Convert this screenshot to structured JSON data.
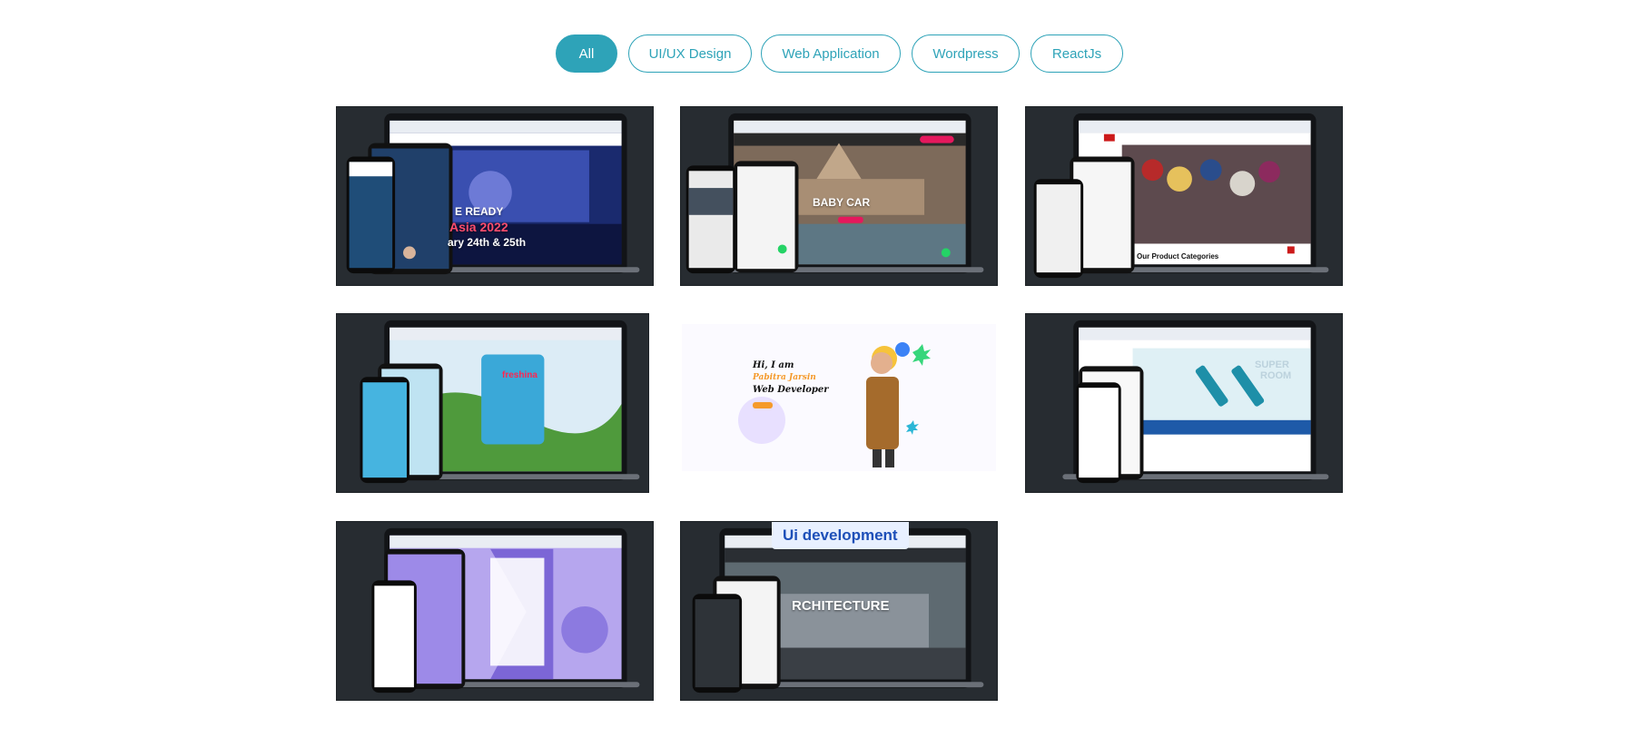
{
  "filters": {
    "all": "All",
    "uiux": "UI/UX Design",
    "webapp": "Web Application",
    "wordpress": "Wordpress",
    "reactjs": "ReactJs",
    "active": "All"
  },
  "colors": {
    "accent": "#2ea3b8",
    "card_bg": "#272c31"
  },
  "portfolio": {
    "items": [
      {
        "overlay_1": "E READY",
        "overlay_2": "Asia 2022",
        "overlay_3": "ary 24th & 25th"
      },
      {
        "overlay_1": "BABY CAR"
      },
      {
        "overlay_1": "Our Product Categories"
      },
      {
        "overlay_1": "freshina"
      },
      {
        "line_1": "Hi, I am",
        "line_2": "Pabitra Jarsin",
        "line_3": "Web Developer"
      },
      {
        "overlay_1": "SUPER",
        "overlay_2": "ROOM"
      },
      {},
      {
        "badge": "Ui development",
        "overlay_1": "RCHITECTURE"
      }
    ]
  }
}
